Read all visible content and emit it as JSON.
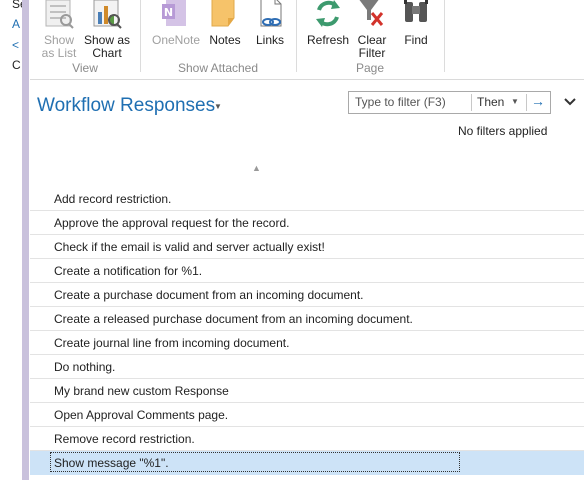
{
  "left_pane": {
    "chars": [
      "Se",
      "A",
      "<",
      "C"
    ]
  },
  "ribbon": {
    "buttons": [
      {
        "label": "Show as List",
        "line1": "Show",
        "line2": "as List",
        "icon": "list-view-icon"
      },
      {
        "label": "Show as Chart",
        "line1": "Show as",
        "line2": "Chart",
        "icon": "chart-view-icon"
      },
      {
        "label": "OneNote",
        "line1": "OneNote",
        "line2": "",
        "icon": "onenote-icon"
      },
      {
        "label": "Notes",
        "line1": "Notes",
        "line2": "",
        "icon": "notes-icon"
      },
      {
        "label": "Links",
        "line1": "Links",
        "line2": "",
        "icon": "links-icon"
      },
      {
        "label": "Refresh",
        "line1": "Refresh",
        "line2": "",
        "icon": "refresh-icon"
      },
      {
        "label": "Clear Filter",
        "line1": "Clear",
        "line2": "Filter",
        "icon": "clear-filter-icon"
      },
      {
        "label": "Find",
        "line1": "Find",
        "line2": "",
        "icon": "binoculars-icon"
      }
    ],
    "groups": [
      "View",
      "Show Attached",
      "Page"
    ]
  },
  "page": {
    "title": "Workflow Responses",
    "filter_placeholder": "Type to filter (F3)",
    "then_label": "Then",
    "filter_status": "No filters applied"
  },
  "responses": [
    "Add record restriction.",
    "Approve the approval request for the record.",
    "Check if the email is valid and server actually exist!",
    "Create a notification for %1.",
    "Create a purchase document from an incoming document.",
    "Create a released purchase document from an incoming document.",
    "Create journal line from incoming document.",
    "Do nothing.",
    "My brand new custom Response",
    "Open Approval Comments page.",
    "Remove record restriction.",
    "Show message \"%1\"."
  ],
  "selected_index": 11,
  "colors": {
    "accent": "#1f6fb2",
    "selection": "#cde3f7",
    "side_bar": "#c9c1dc"
  }
}
